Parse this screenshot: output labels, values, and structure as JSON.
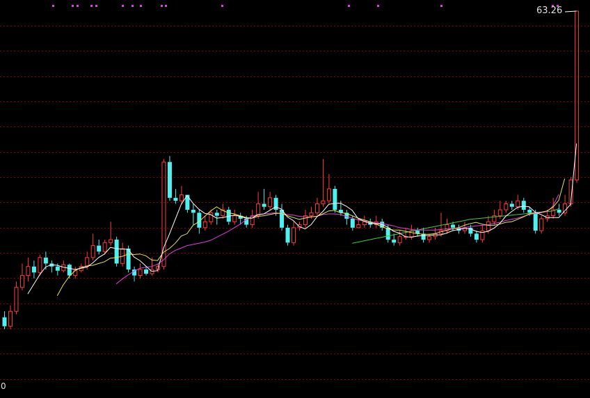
{
  "labels": {
    "last_price": "63.26",
    "axis_zero": "0"
  },
  "colors": {
    "background": "#000000",
    "grid": "#8b0000",
    "up_candle": "#ff3b3b",
    "down_candle": "#4ff0f0",
    "ma5": "#ffffff",
    "ma10": "#e8e84a",
    "ma20": "#e040e0",
    "ma60": "#3fcf3f",
    "markers": "#e040e0"
  },
  "chart_data": {
    "type": "candlestick",
    "title": "",
    "xlabel": "",
    "ylabel": "",
    "ylim": [
      0,
      63.26
    ],
    "grid": true,
    "candles": [
      [
        12.0,
        10.5,
        13.0,
        10.0
      ],
      [
        10.5,
        13.0,
        14.0,
        10.0
      ],
      [
        13.0,
        17.0,
        18.0,
        12.5
      ],
      [
        17.0,
        19.0,
        21.0,
        16.5
      ],
      [
        19.0,
        20.5,
        22.0,
        18.0
      ],
      [
        20.5,
        19.5,
        21.5,
        18.5
      ],
      [
        19.5,
        22.0,
        22.5,
        19.0
      ],
      [
        22.0,
        21.0,
        23.0,
        20.0
      ],
      [
        21.0,
        20.5,
        21.5,
        19.5
      ],
      [
        20.5,
        19.8,
        21.0,
        19.0
      ],
      [
        19.8,
        20.8,
        21.5,
        19.5
      ],
      [
        20.8,
        19.0,
        21.0,
        18.5
      ],
      [
        19.0,
        19.8,
        20.5,
        18.5
      ],
      [
        19.8,
        20.5,
        21.0,
        19.5
      ],
      [
        20.5,
        22.0,
        23.0,
        20.0
      ],
      [
        22.0,
        24.0,
        26.0,
        21.5
      ],
      [
        24.0,
        23.0,
        25.0,
        22.5
      ],
      [
        23.0,
        24.5,
        25.0,
        22.5
      ],
      [
        24.5,
        25.0,
        28.0,
        24.0
      ],
      [
        25.0,
        21.0,
        25.5,
        20.5
      ],
      [
        21.0,
        23.5,
        24.5,
        20.5
      ],
      [
        23.5,
        20.0,
        24.0,
        19.5
      ],
      [
        20.0,
        19.0,
        20.5,
        18.0
      ],
      [
        19.0,
        20.0,
        21.0,
        18.5
      ],
      [
        20.0,
        19.3,
        20.5,
        19.0
      ],
      [
        19.3,
        20.0,
        22.0,
        19.0
      ],
      [
        20.0,
        20.5,
        21.0,
        19.5
      ],
      [
        20.5,
        38.0,
        38.5,
        20.0
      ],
      [
        38.0,
        32.0,
        39.0,
        31.5
      ],
      [
        32.0,
        31.5,
        33.5,
        31.0
      ],
      [
        31.5,
        32.5,
        34.0,
        31.0
      ],
      [
        32.5,
        30.0,
        32.5,
        29.5
      ],
      [
        30.0,
        29.5,
        31.0,
        27.5
      ],
      [
        29.5,
        27.0,
        30.0,
        26.0
      ],
      [
        27.0,
        28.0,
        29.0,
        26.5
      ],
      [
        28.0,
        29.5,
        30.0,
        27.5
      ],
      [
        29.5,
        29.0,
        30.0,
        27.5
      ],
      [
        29.0,
        30.0,
        31.0,
        28.5
      ],
      [
        30.0,
        28.0,
        30.5,
        27.5
      ],
      [
        28.0,
        29.0,
        30.0,
        27.5
      ],
      [
        29.0,
        28.5,
        29.5,
        27.5
      ],
      [
        28.5,
        27.5,
        29.0,
        27.0
      ],
      [
        27.5,
        29.0,
        30.0,
        27.0
      ],
      [
        29.0,
        31.0,
        33.0,
        28.5
      ],
      [
        31.0,
        30.5,
        33.5,
        30.0
      ],
      [
        30.5,
        32.0,
        33.0,
        30.0
      ],
      [
        32.0,
        30.0,
        32.5,
        29.0
      ],
      [
        30.0,
        27.0,
        31.0,
        26.5
      ],
      [
        27.0,
        24.5,
        27.5,
        24.0
      ],
      [
        24.5,
        27.0,
        28.0,
        24.0
      ],
      [
        27.0,
        27.5,
        28.0,
        26.5
      ],
      [
        27.5,
        29.0,
        30.0,
        27.0
      ],
      [
        29.0,
        29.5,
        30.5,
        28.5
      ],
      [
        29.5,
        31.0,
        32.0,
        29.0
      ],
      [
        31.0,
        31.5,
        38.5,
        30.5
      ],
      [
        31.5,
        33.5,
        36.0,
        31.0
      ],
      [
        33.5,
        30.0,
        34.0,
        29.5
      ],
      [
        30.0,
        29.5,
        31.5,
        29.0
      ],
      [
        29.5,
        28.5,
        30.0,
        27.5
      ],
      [
        28.5,
        27.0,
        29.0,
        26.5
      ],
      [
        27.0,
        27.5,
        28.5,
        27.0
      ],
      [
        27.5,
        28.0,
        29.0,
        27.0
      ],
      [
        28.0,
        27.5,
        28.5,
        27.0
      ],
      [
        27.5,
        28.0,
        29.0,
        27.0
      ],
      [
        28.0,
        27.0,
        28.5,
        26.5
      ],
      [
        27.0,
        25.0,
        27.5,
        24.5
      ],
      [
        25.0,
        24.5,
        26.0,
        24.0
      ],
      [
        24.5,
        25.5,
        26.5,
        24.0
      ],
      [
        25.5,
        25.5,
        27.0,
        25.0
      ],
      [
        25.5,
        26.5,
        27.5,
        25.0
      ],
      [
        26.5,
        26.0,
        27.0,
        25.5
      ],
      [
        26.0,
        25.0,
        27.0,
        24.5
      ],
      [
        25.0,
        25.5,
        26.0,
        24.5
      ],
      [
        25.5,
        26.0,
        27.0,
        25.0
      ],
      [
        26.0,
        26.5,
        29.5,
        25.5
      ],
      [
        26.5,
        27.5,
        28.5,
        26.0
      ],
      [
        27.5,
        27.0,
        28.0,
        26.5
      ],
      [
        27.0,
        26.5,
        27.5,
        26.0
      ],
      [
        26.5,
        27.0,
        28.0,
        26.0
      ],
      [
        27.0,
        26.0,
        27.5,
        25.5
      ],
      [
        26.0,
        25.0,
        26.5,
        24.5
      ],
      [
        25.0,
        26.5,
        27.5,
        24.5
      ],
      [
        26.5,
        28.0,
        29.0,
        26.0
      ],
      [
        28.0,
        29.0,
        30.0,
        27.5
      ],
      [
        29.0,
        30.0,
        31.5,
        28.5
      ],
      [
        30.0,
        31.0,
        31.5,
        29.5
      ],
      [
        31.0,
        30.5,
        31.5,
        30.0
      ],
      [
        30.5,
        31.5,
        32.5,
        30.0
      ],
      [
        31.5,
        30.0,
        32.0,
        29.5
      ],
      [
        30.0,
        29.5,
        30.5,
        29.0
      ],
      [
        29.5,
        26.5,
        30.0,
        26.0
      ],
      [
        26.5,
        28.5,
        29.0,
        26.0
      ],
      [
        28.5,
        29.0,
        30.0,
        28.0
      ],
      [
        29.0,
        30.0,
        32.0,
        28.5
      ],
      [
        30.0,
        29.5,
        31.0,
        29.0
      ],
      [
        29.5,
        31.0,
        32.5,
        29.0
      ],
      [
        31.0,
        35.0,
        35.5,
        30.5
      ],
      [
        35.0,
        63.26,
        63.26,
        34.5
      ]
    ],
    "ma5": [
      null,
      null,
      null,
      null,
      15.9,
      17.5,
      19.1,
      20.4,
      20.8,
      20.7,
      20.4,
      20.2,
      20.0,
      20.2,
      20.4,
      21.1,
      22.0,
      22.6,
      23.7,
      23.5,
      23.4,
      23.4,
      22.1,
      21.5,
      20.6,
      19.7,
      19.8,
      23.6,
      25.9,
      28.4,
      30.9,
      32.4,
      31.1,
      30.1,
      29.4,
      29.2,
      28.6,
      28.7,
      28.9,
      29.1,
      28.9,
      28.6,
      28.6,
      29.2,
      29.3,
      29.9,
      30.5,
      30.1,
      28.8,
      28.2,
      27.2,
      26.8,
      27.5,
      28.8,
      29.7,
      30.9,
      31.1,
      31.1,
      30.6,
      29.9,
      28.5,
      28.1,
      27.7,
      27.7,
      27.6,
      27.1,
      26.4,
      26.1,
      25.5,
      25.4,
      25.6,
      25.7,
      25.7,
      25.8,
      25.8,
      26.1,
      26.5,
      26.7,
      26.9,
      26.8,
      26.4,
      26.2,
      26.4,
      26.9,
      27.7,
      28.9,
      29.7,
      30.4,
      30.6,
      30.5,
      29.6,
      29.2,
      28.7,
      28.7,
      28.7,
      29.8,
      30.9,
      41.1
    ],
    "ma10": [
      null,
      null,
      null,
      null,
      null,
      null,
      null,
      null,
      null,
      15.6,
      17.4,
      18.8,
      19.8,
      20.3,
      20.6,
      20.7,
      21.0,
      21.3,
      21.9,
      22.0,
      22.2,
      22.6,
      22.5,
      22.6,
      22.3,
      21.6,
      21.5,
      22.9,
      23.5,
      24.4,
      25.6,
      26.0,
      27.4,
      28.0,
      28.9,
      29.8,
      30.5,
      29.9,
      29.5,
      29.3,
      29.0,
      28.7,
      28.6,
      28.9,
      29.0,
      29.2,
      29.4,
      29.4,
      29.0,
      28.7,
      28.4,
      28.6,
      28.8,
      28.9,
      29.3,
      29.8,
      29.9,
      29.5,
      29.4,
      29.0,
      28.6,
      28.3,
      28.0,
      27.6,
      27.2,
      26.8,
      26.6,
      26.6,
      26.4,
      26.2,
      26.0,
      25.9,
      25.9,
      26.0,
      26.3,
      26.6,
      26.8,
      27.0,
      27.4,
      27.7,
      27.9,
      27.6,
      27.4,
      27.4,
      27.6,
      27.9,
      28.0,
      28.4,
      28.8,
      29.3,
      29.5,
      29.6,
      29.8,
      30.4,
      31.6,
      35.2
    ],
    "ma20": [
      null,
      null,
      null,
      null,
      null,
      null,
      null,
      null,
      null,
      null,
      null,
      null,
      null,
      null,
      null,
      null,
      null,
      null,
      null,
      17.6,
      18.4,
      19.1,
      19.7,
      20.2,
      20.4,
      20.5,
      20.9,
      21.6,
      22.6,
      23.2,
      23.6,
      24.0,
      24.2,
      24.4,
      24.6,
      24.9,
      25.4,
      25.9,
      26.4,
      27.0,
      27.6,
      28.3,
      28.9,
      29.2,
      29.3,
      29.4,
      29.5,
      29.4,
      29.2,
      29.1,
      28.9,
      28.8,
      28.8,
      28.9,
      29.2,
      29.3,
      29.3,
      29.2,
      28.9,
      28.6,
      28.3,
      28.1,
      28.0,
      27.8,
      27.7,
      27.5,
      27.3,
      27.0,
      26.9,
      26.7,
      26.6,
      26.6,
      26.6,
      26.6,
      26.7,
      26.8,
      26.9,
      26.9,
      27.0,
      27.2,
      27.3,
      27.4,
      27.5,
      27.7,
      27.9,
      28.2,
      28.4,
      28.6,
      28.9,
      29.2,
      29.4,
      29.5,
      29.7,
      30.6,
      32.6
    ],
    "ma60": [
      null,
      null,
      null,
      null,
      null,
      null,
      null,
      null,
      null,
      null,
      null,
      null,
      null,
      null,
      null,
      null,
      null,
      null,
      null,
      null,
      null,
      null,
      null,
      null,
      null,
      null,
      null,
      null,
      null,
      null,
      null,
      null,
      null,
      null,
      null,
      null,
      null,
      null,
      null,
      null,
      null,
      null,
      null,
      null,
      null,
      null,
      null,
      null,
      null,
      null,
      null,
      null,
      null,
      null,
      null,
      null,
      null,
      null,
      null,
      24.4,
      24.6,
      24.8,
      25.0,
      25.2,
      25.4,
      25.6,
      25.8,
      26.0,
      26.2,
      26.4,
      26.6,
      26.8,
      27.0,
      27.2,
      27.4,
      27.6,
      27.8,
      28.0,
      28.2,
      28.4,
      28.5,
      28.6,
      28.7,
      28.8,
      28.9,
      29.0,
      29.1,
      29.2,
      29.3,
      29.4,
      29.5,
      29.6,
      29.7,
      29.8,
      30.2
    ]
  }
}
